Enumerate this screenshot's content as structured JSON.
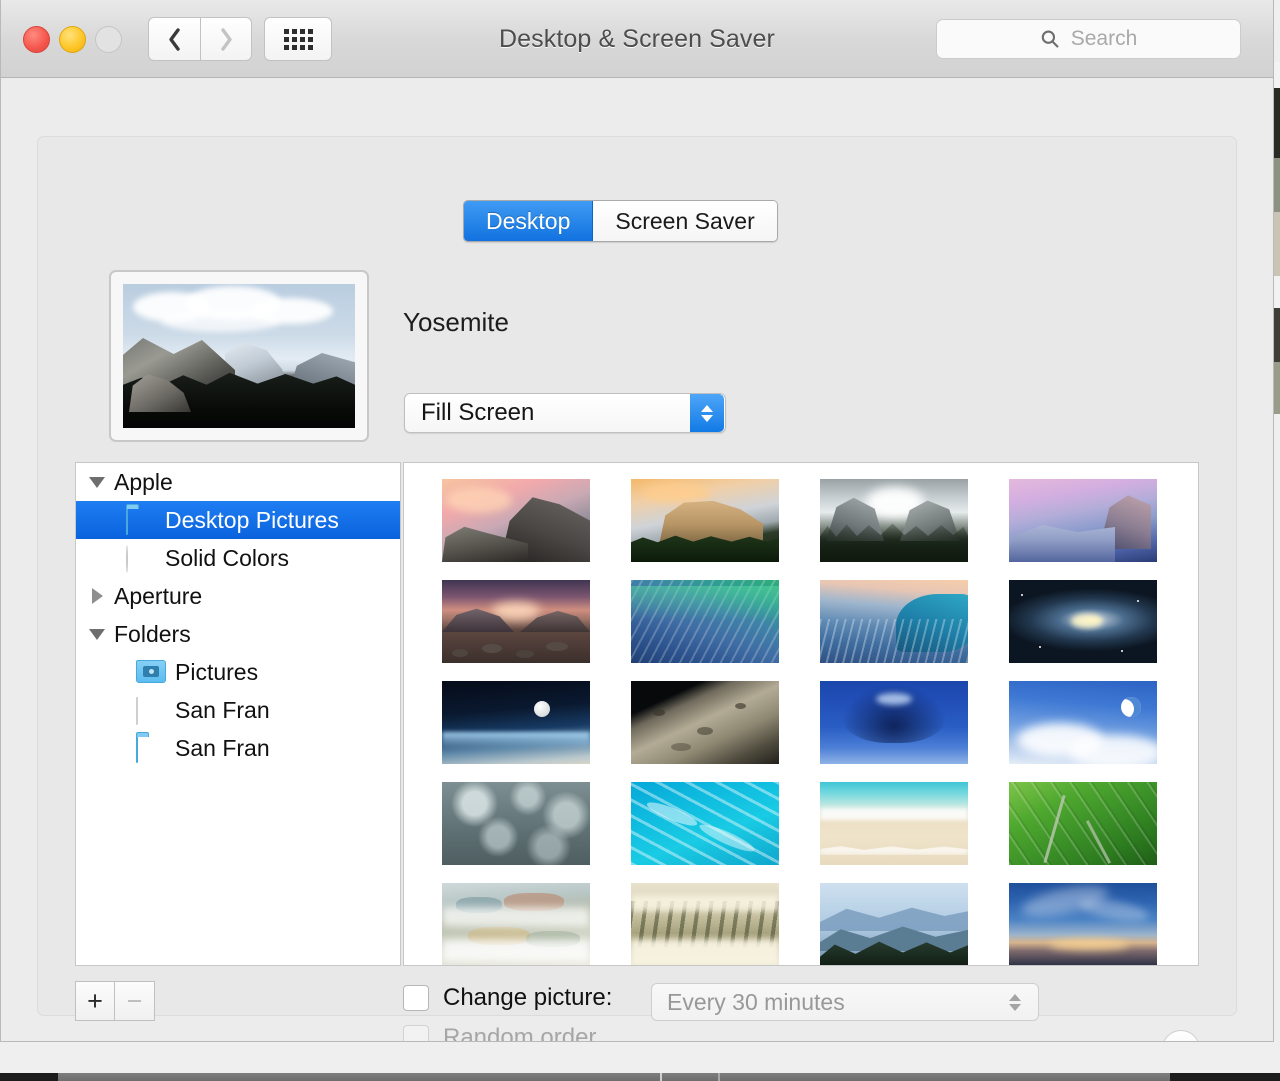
{
  "window": {
    "title": "Desktop & Screen Saver",
    "traffic_lights": [
      "close",
      "minimize",
      "zoom"
    ],
    "nav": {
      "back": "‹",
      "forward": "›",
      "show_all": "show-all-grid"
    }
  },
  "search": {
    "placeholder": "Search",
    "icon": "search-icon"
  },
  "tabs": [
    {
      "label": "Desktop",
      "selected": true
    },
    {
      "label": "Screen Saver",
      "selected": false
    }
  ],
  "preview": {
    "wallpaper_name": "Yosemite",
    "scale_popup": {
      "value": "Fill Screen",
      "enabled": true
    }
  },
  "sidebar": {
    "items": [
      {
        "label": "Apple",
        "kind": "group",
        "disclosure": "down",
        "indent": 0,
        "icon": "none",
        "selected": false
      },
      {
        "label": "Desktop Pictures",
        "kind": "item",
        "disclosure": "none",
        "indent": 1,
        "icon": "folder-blue-icon",
        "selected": true
      },
      {
        "label": "Solid Colors",
        "kind": "item",
        "disclosure": "none",
        "indent": 1,
        "icon": "color-wheel-icon",
        "selected": false
      },
      {
        "label": "Aperture",
        "kind": "group",
        "disclosure": "right",
        "indent": 0,
        "icon": "none",
        "selected": false
      },
      {
        "label": "Folders",
        "kind": "group",
        "disclosure": "down",
        "indent": 0,
        "icon": "none",
        "selected": false
      },
      {
        "label": "Pictures",
        "kind": "item",
        "disclosure": "none",
        "indent": 1,
        "icon": "folder-camera-icon",
        "selected": false
      },
      {
        "label": "San Fran",
        "kind": "item",
        "disclosure": "none",
        "indent": 1,
        "icon": "folder-empty-icon",
        "selected": false
      },
      {
        "label": "San Fran",
        "kind": "item",
        "disclosure": "none",
        "indent": 1,
        "icon": "folder-blue-icon",
        "selected": false
      }
    ],
    "add_button": "+",
    "remove_button": "−"
  },
  "wallpaper_grid": {
    "columns": 4,
    "thumbnails": [
      {
        "name": "Yosemite Half Dome at sunset",
        "style": "sunset-halfdome"
      },
      {
        "name": "El Capitan golden hour",
        "style": "elcapitan-gold"
      },
      {
        "name": "Yosemite Valley fog with pines",
        "style": "valley-fog"
      },
      {
        "name": "Half Dome pink twilight",
        "style": "halfdome-pink"
      },
      {
        "name": "Alpine lake with rocks at dawn",
        "style": "lake-rocks"
      },
      {
        "name": "Mavericks green wave",
        "style": "wave-green"
      },
      {
        "name": "Blue wave at dusk",
        "style": "wave-blue"
      },
      {
        "name": "Andromeda galaxy",
        "style": "galaxy"
      },
      {
        "name": "Earth horizon with moon",
        "style": "earth-moon"
      },
      {
        "name": "Lunar surface from orbit",
        "style": "moon-surface"
      },
      {
        "name": "Blue aurora over dark sky",
        "style": "aurora-blue"
      },
      {
        "name": "Crescent moon in blue sky",
        "style": "crescent-sky"
      },
      {
        "name": "Gray storm clouds",
        "style": "storm-clouds"
      },
      {
        "name": "Turquoise reef channels",
        "style": "reef-turquoise"
      },
      {
        "name": "Beach sand and surf",
        "style": "beach-sand"
      },
      {
        "name": "Green terraced fields aerial",
        "style": "green-fields"
      },
      {
        "name": "Autumn forest in mist",
        "style": "autumn-mist"
      },
      {
        "name": "Sunbeams through foggy forest",
        "style": "sunbeam-fog"
      },
      {
        "name": "Layered blue mountain ridges",
        "style": "blue-ridges"
      },
      {
        "name": "Dusk over distant plain",
        "style": "dusk-plain"
      }
    ]
  },
  "bottom_controls": {
    "change_picture": {
      "label": "Change picture:",
      "checked": false,
      "enabled": true
    },
    "interval": {
      "value": "Every 30 minutes",
      "enabled": false
    },
    "random_order": {
      "label": "Random order",
      "checked": false,
      "enabled": false
    },
    "help": {
      "label": "?"
    }
  }
}
